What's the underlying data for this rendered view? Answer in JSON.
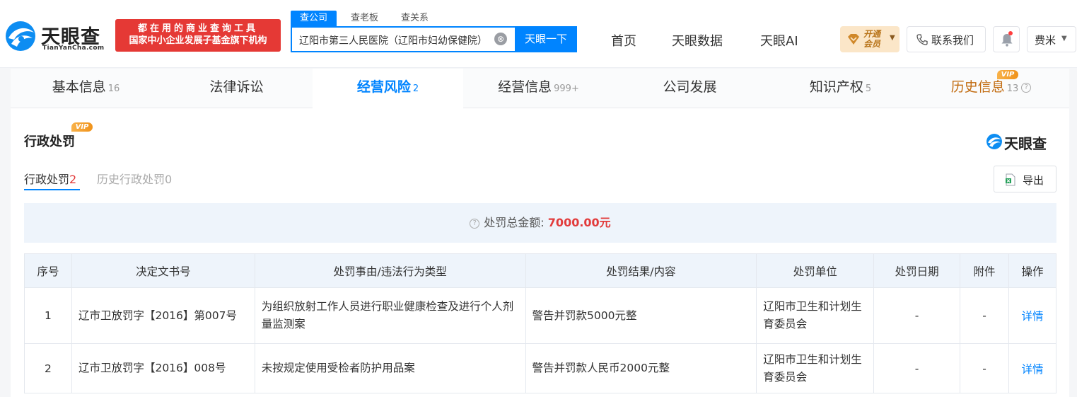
{
  "header": {
    "logo_text": "天眼查",
    "logo_sub": "TianYanCha.com",
    "slogan_line1": "都在用的商业查询工具",
    "slogan_line2": "国家中小企业发展子基金旗下机构",
    "search_tabs": [
      "查公司",
      "查老板",
      "查关系"
    ],
    "search_value": "辽阳市第三人民医院（辽阳市妇幼保健院）",
    "search_clear": "⊗",
    "search_button": "天眼一下",
    "nav": [
      "首页",
      "天眼数据",
      "天眼AI"
    ],
    "vip_line1": "开通",
    "vip_line2": "会员",
    "contact": "联系我们",
    "user": "费米"
  },
  "main_tabs": [
    {
      "label": "基本信息",
      "count": "16"
    },
    {
      "label": "法律诉讼",
      "count": ""
    },
    {
      "label": "经营风险",
      "count": "2"
    },
    {
      "label": "经营信息",
      "count": "999+"
    },
    {
      "label": "公司发展",
      "count": ""
    },
    {
      "label": "知识产权",
      "count": "5"
    },
    {
      "label": "历史信息",
      "count": "13"
    }
  ],
  "vip_badge": "VIP",
  "section": {
    "title": "行政处罚",
    "brand": "天眼查",
    "subtab_active_label": "行政处罚",
    "subtab_active_count": "2",
    "subtab_history_label": "历史行政处罚",
    "subtab_history_count": "0",
    "export": "导出",
    "summary_label": "处罚总金额:",
    "summary_amount": "7000.00元"
  },
  "table": {
    "headers": [
      "序号",
      "决定文书号",
      "处罚事由/违法行为类型",
      "处罚结果/内容",
      "处罚单位",
      "处罚日期",
      "附件",
      "操作"
    ],
    "rows": [
      {
        "index": "1",
        "doc": "辽市卫放罚字【2016】第007号",
        "reason": "为组织放射工作人员进行职业健康检查及进行个人剂量监测案",
        "result": "警告并罚款5000元整",
        "unit": "辽阳市卫生和计划生育委员会",
        "date": "-",
        "attachment": "-",
        "action": "详情"
      },
      {
        "index": "2",
        "doc": "辽市卫放罚字【2016】008号",
        "reason": "未按规定使用受检者防护用品案",
        "result": "警告并罚款人民币2000元整",
        "unit": "辽阳市卫生和计划生育委员会",
        "date": "-",
        "attachment": "-",
        "action": "详情"
      }
    ]
  },
  "colors": {
    "primary": "#0084ff",
    "danger": "#e23b3b",
    "vip_gold": "#c26c11",
    "slogan_bg": "#e53935"
  }
}
